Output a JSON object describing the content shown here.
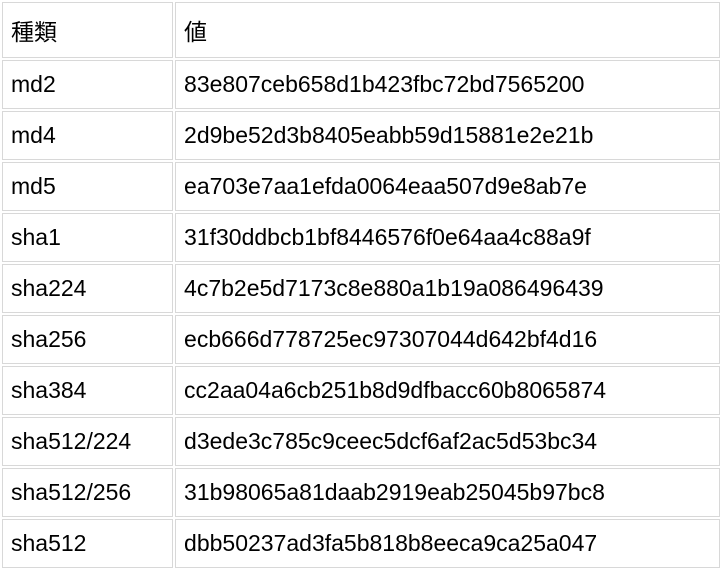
{
  "table": {
    "headers": {
      "type": "種類",
      "value": "値"
    },
    "rows": [
      {
        "type": "md2",
        "value": "83e807ceb658d1b423fbc72bd7565200"
      },
      {
        "type": "md4",
        "value": "2d9be52d3b8405eabb59d15881e2e21b"
      },
      {
        "type": "md5",
        "value": "ea703e7aa1efda0064eaa507d9e8ab7e"
      },
      {
        "type": "sha1",
        "value": "31f30ddbcb1bf8446576f0e64aa4c88a9f"
      },
      {
        "type": "sha224",
        "value": "4c7b2e5d7173c8e880a1b19a086496439"
      },
      {
        "type": "sha256",
        "value": "ecb666d778725ec97307044d642bf4d16"
      },
      {
        "type": "sha384",
        "value": "cc2aa04a6cb251b8d9dfbacc60b8065874"
      },
      {
        "type": "sha512/224",
        "value": "d3ede3c785c9ceec5dcf6af2ac5d53bc34"
      },
      {
        "type": "sha512/256",
        "value": "31b98065a81daab2919eab25045b97bc8"
      },
      {
        "type": "sha512",
        "value": "dbb50237ad3fa5b818b8eeca9ca25a047"
      }
    ]
  }
}
